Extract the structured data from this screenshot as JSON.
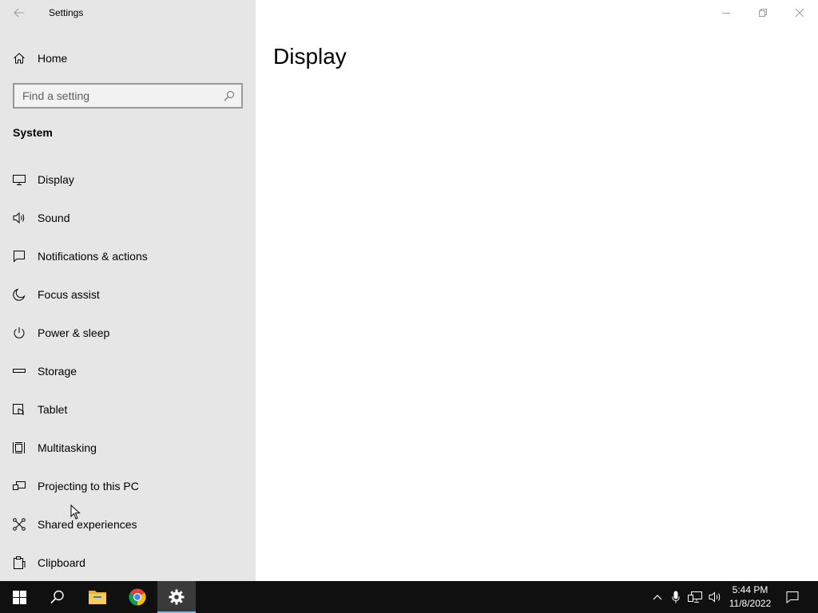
{
  "window": {
    "app_title": "Settings",
    "back_icon": "back-arrow-icon",
    "controls": [
      "minimize-icon",
      "restore-icon",
      "close-icon"
    ]
  },
  "sidebar": {
    "home_label": "Home",
    "search_placeholder": "Find a setting",
    "section_title": "System",
    "items": [
      {
        "label": "Display",
        "icon": "monitor-icon"
      },
      {
        "label": "Sound",
        "icon": "speaker-icon"
      },
      {
        "label": "Notifications & actions",
        "icon": "notification-icon"
      },
      {
        "label": "Focus assist",
        "icon": "moon-icon"
      },
      {
        "label": "Power & sleep",
        "icon": "power-icon"
      },
      {
        "label": "Storage",
        "icon": "storage-icon"
      },
      {
        "label": "Tablet",
        "icon": "tablet-icon"
      },
      {
        "label": "Multitasking",
        "icon": "multitasking-icon"
      },
      {
        "label": "Projecting to this PC",
        "icon": "projecting-icon"
      },
      {
        "label": "Shared experiences",
        "icon": "shared-experiences-icon"
      },
      {
        "label": "Clipboard",
        "icon": "clipboard-icon"
      }
    ]
  },
  "main": {
    "page_title": "Display"
  },
  "taskbar": {
    "pinned": [
      "windows-start-icon",
      "search-icon",
      "file-explorer-icon",
      "chrome-icon",
      "settings-icon"
    ],
    "active": "settings-icon",
    "tray_icons": [
      "chevron-up-icon",
      "microphone-icon",
      "network-icon",
      "volume-icon",
      "action-center-icon"
    ],
    "time": "5:44 PM",
    "date": "11/8/2022"
  },
  "colors": {
    "sidebar_bg": "#e6e6e6",
    "taskbar_bg": "#101010",
    "active_underline": "#7fb2e0"
  }
}
